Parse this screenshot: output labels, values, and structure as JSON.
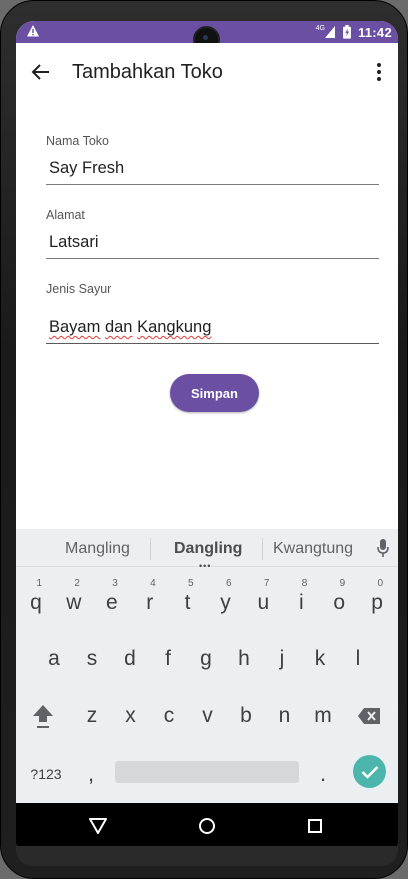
{
  "status_bar": {
    "time": "11:42",
    "signal_label": "4G",
    "icons": [
      "warning-icon",
      "signal-icon",
      "battery-icon"
    ],
    "color": "#6a4fa3"
  },
  "app_bar": {
    "title": "Tambahkan Toko",
    "back_icon": "arrow-back-icon",
    "more_icon": "more-vert-icon"
  },
  "form": {
    "store_name": {
      "label": "Nama Toko",
      "value": "Say Fresh"
    },
    "address": {
      "label": "Alamat",
      "value": "Latsari"
    },
    "vegetable_type": {
      "label": "Jenis Sayur",
      "words": [
        "Bayam",
        "dan",
        "Kangkung"
      ]
    },
    "save_label": "Simpan"
  },
  "keyboard": {
    "suggestions": [
      "Mangling",
      "Dangling",
      "Kwangtung"
    ],
    "row1": [
      {
        "ch": "q",
        "hint": "1"
      },
      {
        "ch": "w",
        "hint": "2"
      },
      {
        "ch": "e",
        "hint": "3"
      },
      {
        "ch": "r",
        "hint": "4"
      },
      {
        "ch": "t",
        "hint": "5"
      },
      {
        "ch": "y",
        "hint": "6"
      },
      {
        "ch": "u",
        "hint": "7"
      },
      {
        "ch": "i",
        "hint": "8"
      },
      {
        "ch": "o",
        "hint": "9"
      },
      {
        "ch": "p",
        "hint": "0"
      }
    ],
    "row2": [
      "a",
      "s",
      "d",
      "f",
      "g",
      "h",
      "j",
      "k",
      "l"
    ],
    "row3": [
      "z",
      "x",
      "c",
      "v",
      "b",
      "n",
      "m"
    ],
    "symbols_label": "?123",
    "comma": ",",
    "period": ".",
    "accent": "#4db6ac"
  },
  "nav_bar": {
    "icons": [
      "nav-back-icon",
      "nav-home-icon",
      "nav-recents-icon"
    ]
  }
}
